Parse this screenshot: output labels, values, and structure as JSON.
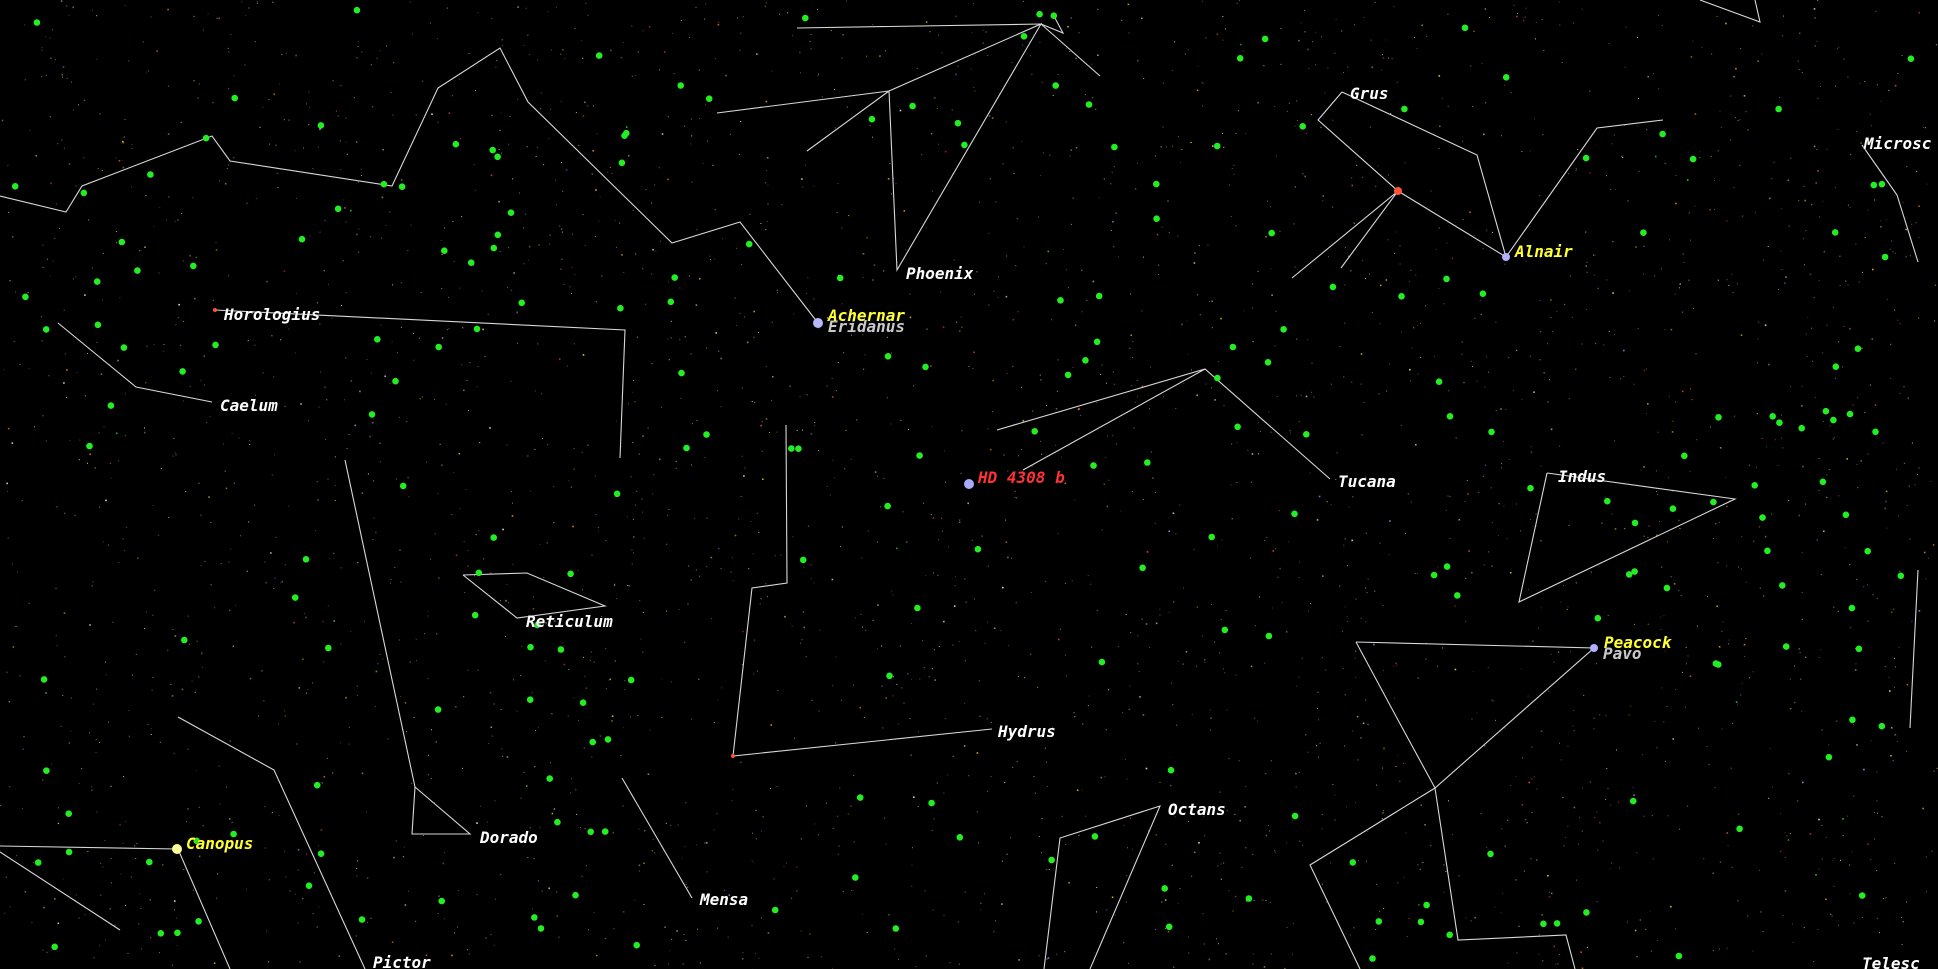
{
  "colors": {
    "background": "#000000",
    "constellation_line": "#d8d8d8",
    "constellation_label": "#ffffff",
    "star_label": "#ffff33",
    "planet_label": "#ff3333",
    "object_dot": "#22ee22"
  },
  "constellations": [
    {
      "id": "horologium",
      "name": "Horologius"
    },
    {
      "id": "caelum",
      "name": "Caelum"
    },
    {
      "id": "eridanus",
      "name": "Eridanus"
    },
    {
      "id": "phoenix",
      "name": "Phoenix"
    },
    {
      "id": "grus",
      "name": "Grus"
    },
    {
      "id": "microscopium",
      "name": "Microsc"
    },
    {
      "id": "tucana",
      "name": "Tucana"
    },
    {
      "id": "indus",
      "name": "Indus"
    },
    {
      "id": "pavo",
      "name": "Pavo"
    },
    {
      "id": "reticulum",
      "name": "Reticulum"
    },
    {
      "id": "hydrus",
      "name": "Hydrus"
    },
    {
      "id": "octans",
      "name": "Octans"
    },
    {
      "id": "dorado",
      "name": "Dorado"
    },
    {
      "id": "mensa",
      "name": "Mensa"
    },
    {
      "id": "pictor",
      "name": "Pictor"
    },
    {
      "id": "telescopium",
      "name": "Telesc"
    }
  ],
  "stars": [
    {
      "id": "achernar",
      "name": "Achernar"
    },
    {
      "id": "alnair",
      "name": "Alnair"
    },
    {
      "id": "peacock",
      "name": "Peacock"
    },
    {
      "id": "canopus",
      "name": "Canopus"
    }
  ],
  "planets": [
    {
      "id": "hd4308b",
      "name": "HD 4308 b"
    }
  ]
}
